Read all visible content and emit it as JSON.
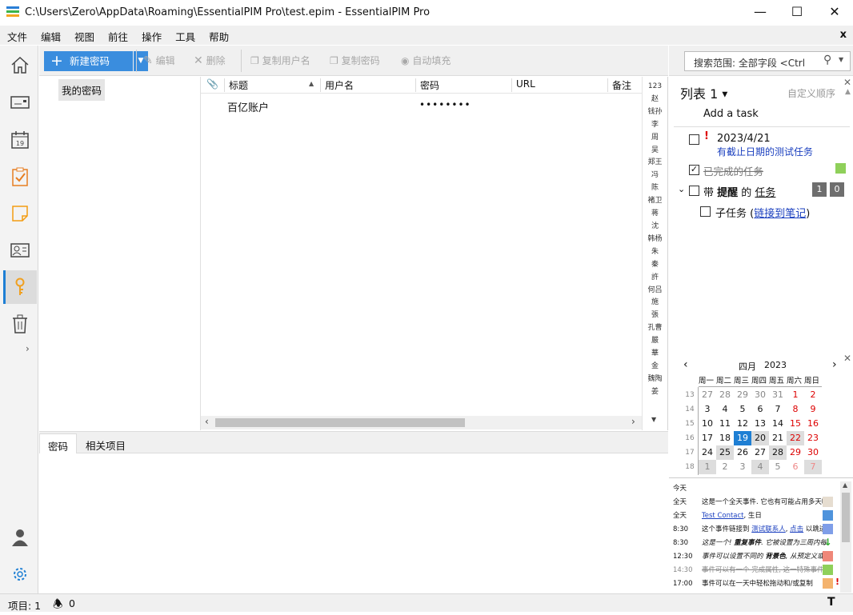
{
  "window": {
    "title": "C:\\Users\\Zero\\AppData\\Roaming\\EssentialPIM Pro\\test.epim - EssentialPIM Pro"
  },
  "menu": {
    "items": [
      "文件",
      "编辑",
      "视图",
      "前往",
      "操作",
      "工具",
      "帮助"
    ]
  },
  "toolbar": {
    "new_password": "新建密码",
    "edit": "编辑",
    "delete": "删除",
    "copy_username": "复制用户名",
    "copy_password": "复制密码",
    "autofill": "自动填充"
  },
  "search": {
    "placeholder": "搜索范围: 全部字段  <Ctrl"
  },
  "folders": {
    "items": [
      "我的密码"
    ]
  },
  "grid": {
    "columns": [
      "标题",
      "用户名",
      "密码",
      "URL",
      "备注"
    ],
    "rows": [
      {
        "title": "百亿账户",
        "username": "",
        "password": "••••••••",
        "url": "",
        "notes": ""
      }
    ]
  },
  "alpha_index": [
    "123",
    "赵",
    "钱孙",
    "李",
    "周",
    "吴",
    "郑王",
    "冯",
    "陈",
    "褚卫",
    "蒋",
    "沈",
    "韩杨",
    "朱",
    "秦",
    "許",
    "何吕",
    "施",
    "張",
    "孔曹",
    "嚴",
    "華",
    "金",
    "魏陶",
    "姜"
  ],
  "bottom_tabs": [
    "密码",
    "相关项目"
  ],
  "tasks": {
    "list_name": "列表 1",
    "custom_order": "自定义顺序",
    "add_task": "Add a task",
    "items": [
      {
        "date": "2023/4/21",
        "title": "有截止日期的测试任务"
      },
      {
        "title": "已完成的任务",
        "color": "#8fd05a"
      },
      {
        "title_pre": "带 ",
        "title_bold": "提醒",
        "title_mid": " 的 ",
        "title_task": "任务",
        "badge1": "1",
        "badge2": "0"
      },
      {
        "title_pre": "子任务 (",
        "link": "链接到笔记",
        "title_post": ")"
      }
    ]
  },
  "calendar": {
    "month": "四月",
    "year": "2023",
    "weekday_headers": [
      "周一",
      "周二",
      "周三",
      "周四",
      "周五",
      "周六",
      "周日"
    ],
    "weeks": [
      {
        "wk": "13",
        "days": [
          "27",
          "28",
          "29",
          "30",
          "31",
          "1",
          "2"
        ]
      },
      {
        "wk": "14",
        "days": [
          "3",
          "4",
          "5",
          "6",
          "7",
          "8",
          "9"
        ]
      },
      {
        "wk": "15",
        "days": [
          "10",
          "11",
          "12",
          "13",
          "14",
          "15",
          "16"
        ]
      },
      {
        "wk": "16",
        "days": [
          "17",
          "18",
          "19",
          "20",
          "21",
          "22",
          "23"
        ]
      },
      {
        "wk": "17",
        "days": [
          "24",
          "25",
          "26",
          "27",
          "28",
          "29",
          "30"
        ]
      },
      {
        "wk": "18",
        "days": [
          "1",
          "2",
          "3",
          "4",
          "5",
          "6",
          "7"
        ]
      }
    ]
  },
  "agenda": {
    "today_label": "今天",
    "items": [
      {
        "time": "全天",
        "text": "这是一个全天事件. 它也有可能占用多天哦",
        "color": "#e6ddd0"
      },
      {
        "time": "全天",
        "link": "Test Contact",
        "text": ", 生日",
        "color": "#4f93dc"
      },
      {
        "time": "8:30",
        "pre": "这个事件链接到 ",
        "link": "测试联系人",
        "mid": ", ",
        "link2": "点击",
        "text": " 以跳进",
        "color": "#7f9ee8"
      },
      {
        "time": "8:30",
        "pre": "这是一个! ",
        "bold": "重复事件",
        "text": ". 它被设置为三周内每",
        "arrow": "↓"
      },
      {
        "time": "12:30",
        "pre": "事件可以设置不同的 ",
        "bold": "背景色",
        "text": ", 从预定义或自",
        "color": "#ef8779"
      },
      {
        "time": "14:30",
        "text": "事件可以有一个 完成属性, 这一特殊事件已",
        "color": "#8fd05a",
        "struck": true
      },
      {
        "time": "17:00",
        "text": "事件可以在一天中轻松拖动和/或复制",
        "color": "#f4b36e",
        "mark": "!"
      }
    ]
  },
  "status": {
    "items_label": "项目: 1",
    "reminders": "0"
  }
}
